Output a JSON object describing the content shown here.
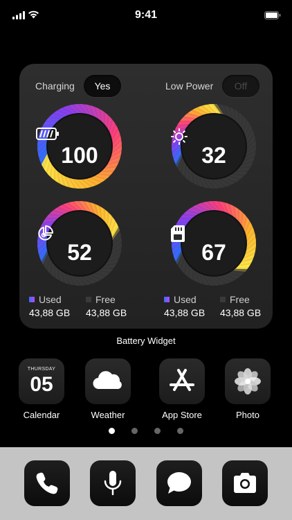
{
  "status_bar": {
    "time": "9:41"
  },
  "widget": {
    "charging_label": "Charging",
    "charging_value": "Yes",
    "low_power_label": "Low Power",
    "low_power_value": "Off",
    "gauges": [
      {
        "value": "100",
        "icon": "battery-icon",
        "level": 1.0
      },
      {
        "value": "32",
        "icon": "sun-icon",
        "level": 0.32
      },
      {
        "value": "52",
        "icon": "pie-chart-icon",
        "level": 0.52
      },
      {
        "value": "67",
        "icon": "sd-card-icon",
        "level": 0.67
      }
    ],
    "legends": [
      {
        "used_label": "Used",
        "used_value": "43,88 GB",
        "free_label": "Free",
        "free_value": "43,88 GB"
      },
      {
        "used_label": "Used",
        "used_value": "43,88 GB",
        "free_label": "Free",
        "free_value": "43,88 GB"
      }
    ],
    "caption": "Battery Widget"
  },
  "apps": [
    {
      "name": "Calendar",
      "icon": "calendar-icon",
      "day": "THURSDAY",
      "date": "05"
    },
    {
      "name": "Weather",
      "icon": "cloud-icon"
    },
    {
      "name": "App Store",
      "icon": "app-store-icon"
    },
    {
      "name": "Photo",
      "icon": "flower-icon"
    }
  ],
  "page_dots": {
    "count": 4,
    "active": 0
  },
  "dock": [
    {
      "icon": "phone-icon"
    },
    {
      "icon": "microphone-icon"
    },
    {
      "icon": "message-icon"
    },
    {
      "icon": "camera-icon"
    }
  ],
  "colors": {
    "gradient": [
      "#2f6fff",
      "#8a3ff0",
      "#ff3f7a",
      "#ffb52e",
      "#ffe84a"
    ],
    "track": "#3a3a3a",
    "bezel": "#1c1c1c"
  }
}
